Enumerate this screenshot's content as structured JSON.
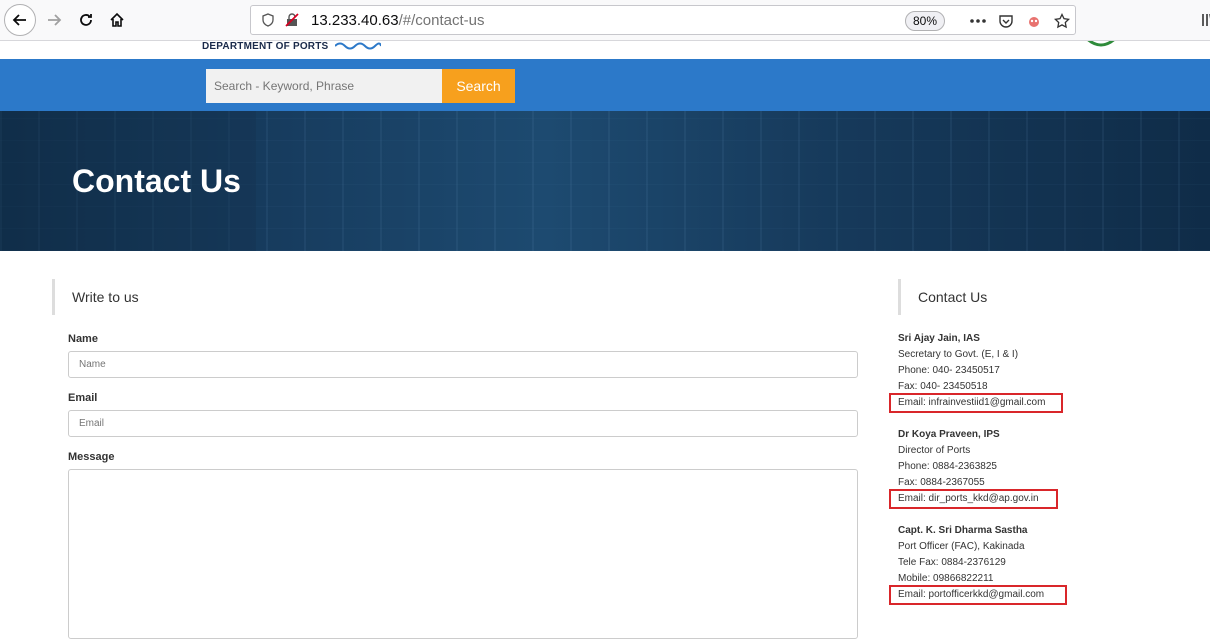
{
  "browser": {
    "url_host": "13.233.40.63",
    "url_path": "/#/contact-us",
    "zoom": "80%"
  },
  "site": {
    "department": "DEPARTMENT OF PORTS",
    "search_placeholder": "Search - Keyword, Phrase",
    "search_button": "Search"
  },
  "hero": {
    "title": "Contact Us"
  },
  "form": {
    "heading": "Write to us",
    "name_label": "Name",
    "name_placeholder": "Name",
    "email_label": "Email",
    "email_placeholder": "Email",
    "message_label": "Message"
  },
  "contacts": {
    "heading": "Contact Us",
    "people": [
      {
        "name": "Sri Ajay Jain, IAS",
        "line1": "Secretary to Govt. (E, I & I)",
        "line2": "Phone: 040- 23450517",
        "line3": "Fax: 040- 23450518",
        "email": "Email: infrainvestiid1@gmail.com"
      },
      {
        "name": "Dr Koya Praveen, IPS",
        "line1": "Director of Ports",
        "line2": "Phone: 0884-2363825",
        "line3": "Fax: 0884-2367055",
        "email": "Email: dir_ports_kkd@ap.gov.in"
      },
      {
        "name": "Capt. K. Sri Dharma Sastha",
        "line1": "Port Officer (FAC), Kakinada",
        "line2": "Tele Fax: 0884-2376129",
        "line3": "Mobile: 09866822211",
        "email": "Email: portofficerkkd@gmail.com"
      }
    ]
  },
  "colors": {
    "header_blue": "#2c79c9",
    "search_orange": "#f7a01d",
    "highlight_red": "#d9262a"
  }
}
